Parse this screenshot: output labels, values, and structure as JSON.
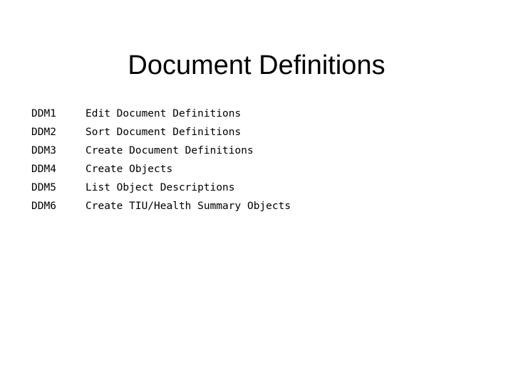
{
  "slide": {
    "title": "Document Definitions",
    "background_color": "#ffffff",
    "text_color": "#000000",
    "menu_items": [
      {
        "code": "DDM1",
        "description": "Edit Document Definitions"
      },
      {
        "code": "DDM2",
        "description": "Sort Document Definitions"
      },
      {
        "code": "DDM3",
        "description": "Create Document Definitions"
      },
      {
        "code": "DDM4",
        "description": "Create Objects"
      },
      {
        "code": "DDM5",
        "description": "List Object Descriptions"
      },
      {
        "code": "DDM6",
        "description": "Create TIU/Health Summary Objects"
      }
    ]
  }
}
